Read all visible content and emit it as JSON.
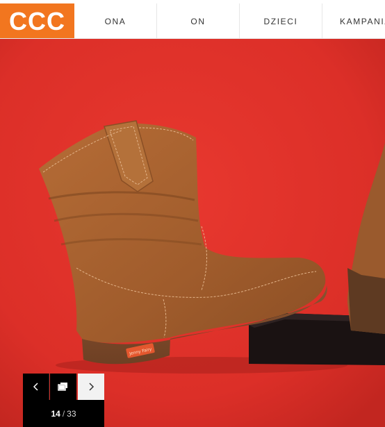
{
  "header": {
    "logo_text": "CCC",
    "nav": [
      {
        "label": "ONA"
      },
      {
        "label": "ON"
      },
      {
        "label": "DZIECI"
      },
      {
        "label": "KAMPANIA"
      }
    ]
  },
  "hero": {
    "background_color": "#e0302a",
    "boot_label": "Jenny Fairy",
    "image_icon": "boot-photo"
  },
  "gallery": {
    "current": "14",
    "separator": "/",
    "total": "33",
    "prev_icon": "chevron-left-icon",
    "fullscreen_icon": "fullscreen-icon",
    "next_icon": "chevron-right-icon"
  },
  "colors": {
    "brand": "#f2761f",
    "boot": "#a4602f",
    "controls_bg": "#000000"
  }
}
